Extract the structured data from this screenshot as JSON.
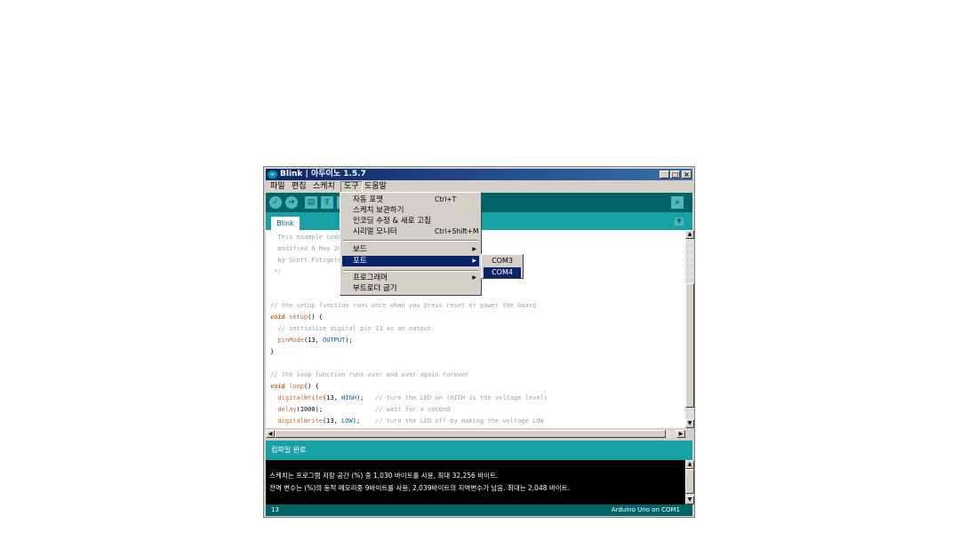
{
  "window": {
    "title": "Blink | 아두이노 1.5.7",
    "icon": "infinity-icon",
    "controls": {
      "minimize": "_",
      "maximize": "□",
      "close": "×"
    }
  },
  "menubar": [
    "파일",
    "편집",
    "스케치",
    "도구",
    "도움말"
  ],
  "toolbar": {
    "verify_icon": "check-icon",
    "upload_icon": "arrow-right-icon",
    "new_icon": "new-file-icon",
    "open_icon": "open-arrow-up-icon",
    "serial_monitor_icon": "magnifier-icon"
  },
  "tab": {
    "label": "Blink",
    "dropdown": "▼"
  },
  "code_lines": [
    "  This example code",
    "",
    "  modified 8 May 20",
    "  by Scott Fitzgers",
    " */",
    "",
    "",
    "// the setup function runs once when you press reset or power the board",
    "void setup() {",
    "  // initialize digital pin 13 as an output.",
    "  pinMode(13, OUTPUT);",
    "}",
    "",
    "// the loop function runs over and over again forever",
    "void loop() {",
    "  digitalWrite(13, HIGH);   // turn the LED on (HIGH is the voltage level)",
    "  delay(1000);              // wait for a second",
    "  digitalWrite(13, LOW);    // turn the LED off by making the voltage LOW"
  ],
  "status": {
    "message": "컴파일 완료."
  },
  "console": {
    "lines": [
      "스케치는 프로그램 저장 공간 (%) 중 1,030 바이트를 사용, 최대 32,256 바이트.",
      "전역 변수는 (%)의 동적 메모리중 9바이트를 사용, 2,039바이트의 지역변수가 남음. 최대는 2,048 바이트."
    ]
  },
  "footer": {
    "line": "13",
    "board": "Arduino Uno on COM1"
  },
  "tools_menu": {
    "items": [
      {
        "label": "자동 포맷",
        "shortcut": "Ctrl+T"
      },
      {
        "label": "스케치 보관하기",
        "shortcut": ""
      },
      {
        "label": "인코딩 수정 & 새로 고침",
        "shortcut": ""
      },
      {
        "label": "시리얼 모니터",
        "shortcut": "Ctrl+Shift+M"
      },
      {
        "label": "보드",
        "submenu": true
      },
      {
        "label": "포트",
        "submenu": true,
        "highlighted": true
      },
      {
        "label": "프로그래머",
        "submenu": true
      },
      {
        "label": "부트로더 굽기"
      }
    ],
    "submenu_arrow": "▶"
  },
  "port_submenu": {
    "items": [
      "COM3",
      "COM4"
    ],
    "highlighted": "COM4"
  },
  "colors": {
    "teal_dark": "#006468",
    "teal": "#17a1a5",
    "highlight": "#0a246a"
  }
}
